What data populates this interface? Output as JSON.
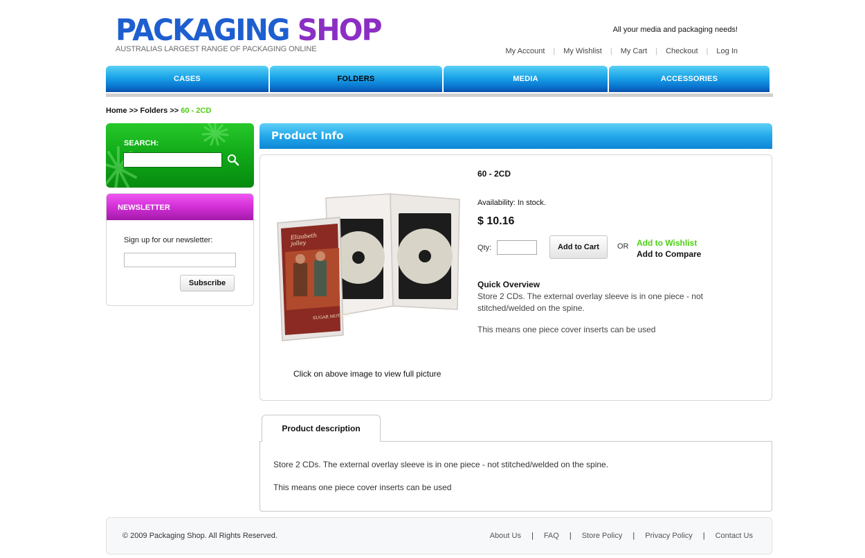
{
  "header": {
    "logo_part1": "PACKAGING",
    "logo_part2": "SHOP",
    "logo_subtitle": "AUSTRALIAS LARGEST RANGE OF PACKAGING ONLINE",
    "tagline": "All your media and packaging needs!",
    "links": [
      "My Account",
      "My Wishlist",
      "My Cart",
      "Checkout",
      "Log In"
    ]
  },
  "nav": {
    "items": [
      "CASES",
      "FOLDERS",
      "MEDIA",
      "ACCESSORIES"
    ],
    "active": "FOLDERS"
  },
  "breadcrumb": {
    "home": "Home",
    "sep": ">>",
    "category": "Folders",
    "current": "60 - 2CD"
  },
  "sidebar": {
    "search_label": "SEARCH:",
    "search_value": "",
    "newsletter_title": "NEWSLETTER",
    "newsletter_text": "Sign up for our newsletter:",
    "subscribe_label": "Subscribe"
  },
  "product": {
    "section_title": "Product Info",
    "name": "60 - 2CD",
    "availability": "Availability: In stock.",
    "price": "$ 10.16",
    "qty_label": "Qty:",
    "qty_value": "",
    "add_to_cart": "Add to Cart",
    "or": "OR",
    "add_to_wishlist": "Add to Wishlist",
    "add_to_compare": "Add to Compare",
    "quick_overview_title": "Quick Overview",
    "quick_overview_text": "Store 2 CDs. The external overlay sleeve is in one piece - not stitched/welded on the spine.",
    "quick_overview_text2": "This means one piece cover inserts can be used",
    "image_caption": "Click on above image to view full picture",
    "cover_title": "Elizabeth jolley",
    "cover_subtitle": "SUGAR MOTHER"
  },
  "tabs": {
    "description_label": "Product description",
    "description_p1": "Store 2 CDs. The external overlay sleeve is in one piece - not stitched/welded on the spine.",
    "description_p2": "This means one piece cover inserts can be used"
  },
  "footer": {
    "copyright": "© 2009 Packaging Shop. All Rights Reserved.",
    "links": [
      "About Us",
      "FAQ",
      "Store Policy",
      "Privacy Policy",
      "Contact Us"
    ]
  },
  "colors": {
    "nav_blue": "#1aa3e8",
    "search_green": "#10a818",
    "newsletter_magenta": "#d22fd6",
    "link_green": "#4ccf12",
    "logo_blue": "#1e5fd0",
    "logo_purple": "#8b2fc4"
  }
}
